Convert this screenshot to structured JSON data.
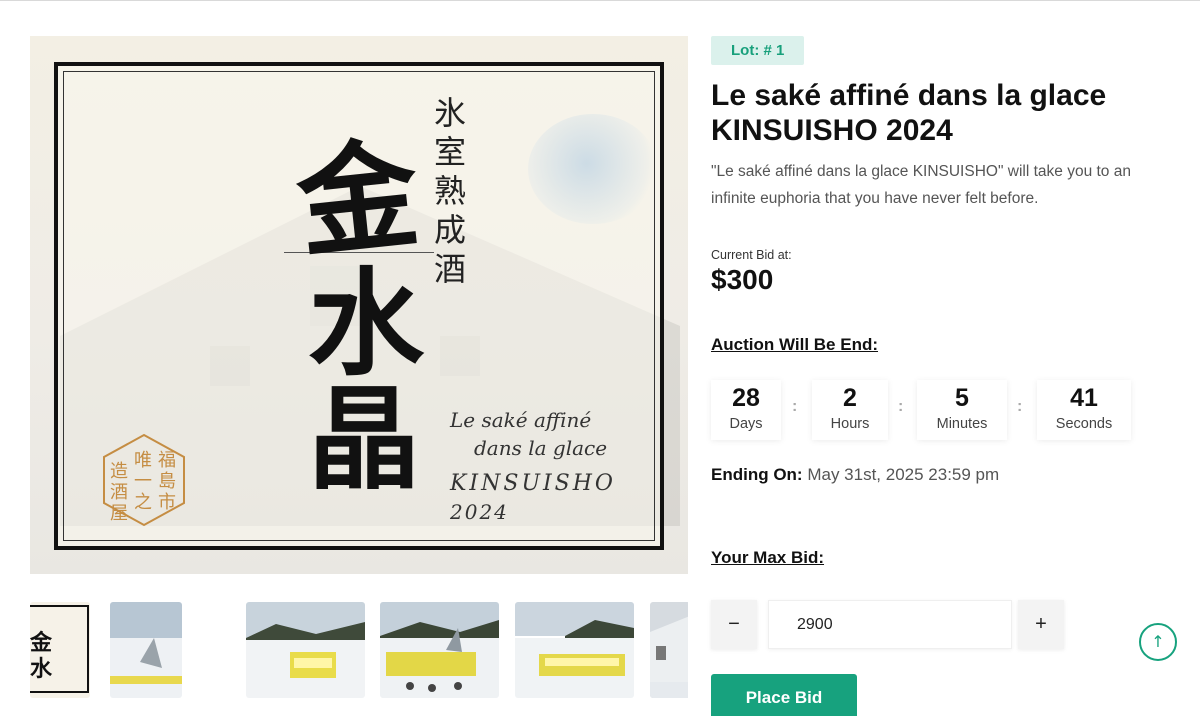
{
  "product": {
    "lot": "Lot: # 1",
    "title": "Le saké affiné dans la glace KINSUISHO 2024",
    "description": "\"Le saké affiné dans la glace KINSUISHO\" will take you to an infinite euphoria that you have never felt before."
  },
  "label_art": {
    "vertical_text": "氷室熟成酒",
    "big_chars": [
      "金",
      "水",
      "晶"
    ],
    "script_lines": [
      "Le saké affiné",
      "dans la glace",
      "KINSUISHO",
      "2024"
    ],
    "seal_text": "福島市唯一之造酒屋"
  },
  "bid": {
    "current_label": "Current Bid at:",
    "current_value": "$300",
    "auction_end_label": "Auction Will Be End:",
    "ending_label": "Ending On:",
    "ending_value": "May 31st, 2025 23:59 pm",
    "max_bid_label": "Your Max Bid:",
    "max_bid_value": "2900",
    "decrement": "−",
    "increment": "+",
    "place_bid": "Place Bid"
  },
  "countdown": [
    {
      "value": "28",
      "unit": "Days"
    },
    {
      "value": "2",
      "unit": "Hours"
    },
    {
      "value": "5",
      "unit": "Minutes"
    },
    {
      "value": "41",
      "unit": "Seconds"
    }
  ],
  "countdown_sep": ":",
  "scroll_top_icon": "↑",
  "colors": {
    "accent": "#17a27e",
    "badge_bg": "#dbf1ec"
  }
}
